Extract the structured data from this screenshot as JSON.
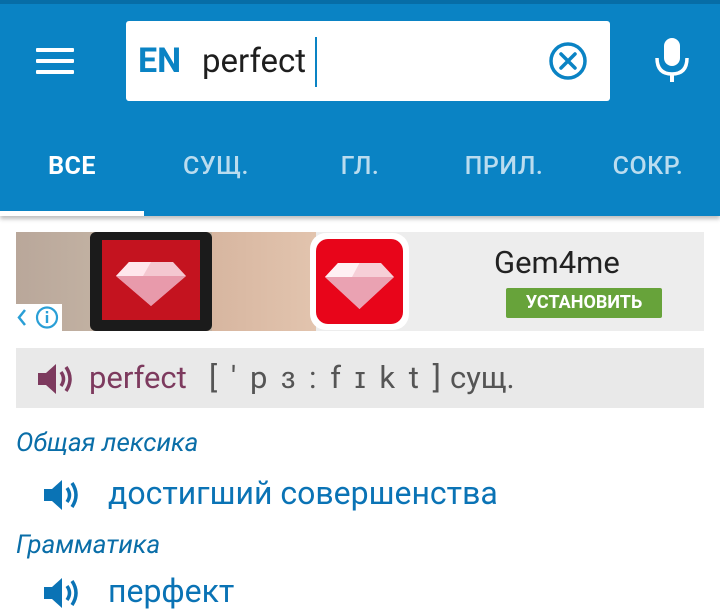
{
  "search": {
    "lang": "EN",
    "query": "perfect"
  },
  "tabs": [
    {
      "label": "ВСЕ"
    },
    {
      "label": "СУЩ."
    },
    {
      "label": "ГЛ."
    },
    {
      "label": "ПРИЛ."
    },
    {
      "label": "СОКР."
    }
  ],
  "ad": {
    "title": "Gem4me",
    "install_label": "УСТАНОВИТЬ"
  },
  "entry": {
    "word": "perfect",
    "transcription": "[ ' p ɜ : f ɪ k t ]",
    "pos": "сущ."
  },
  "sections": [
    {
      "label": "Общая лексика",
      "meaning": "достигший совершенства"
    },
    {
      "label": "Грамматика",
      "meaning": "перфект"
    }
  ],
  "colors": {
    "primary": "#0a83c4",
    "word": "#7d3a5e",
    "install": "#67a33a"
  }
}
